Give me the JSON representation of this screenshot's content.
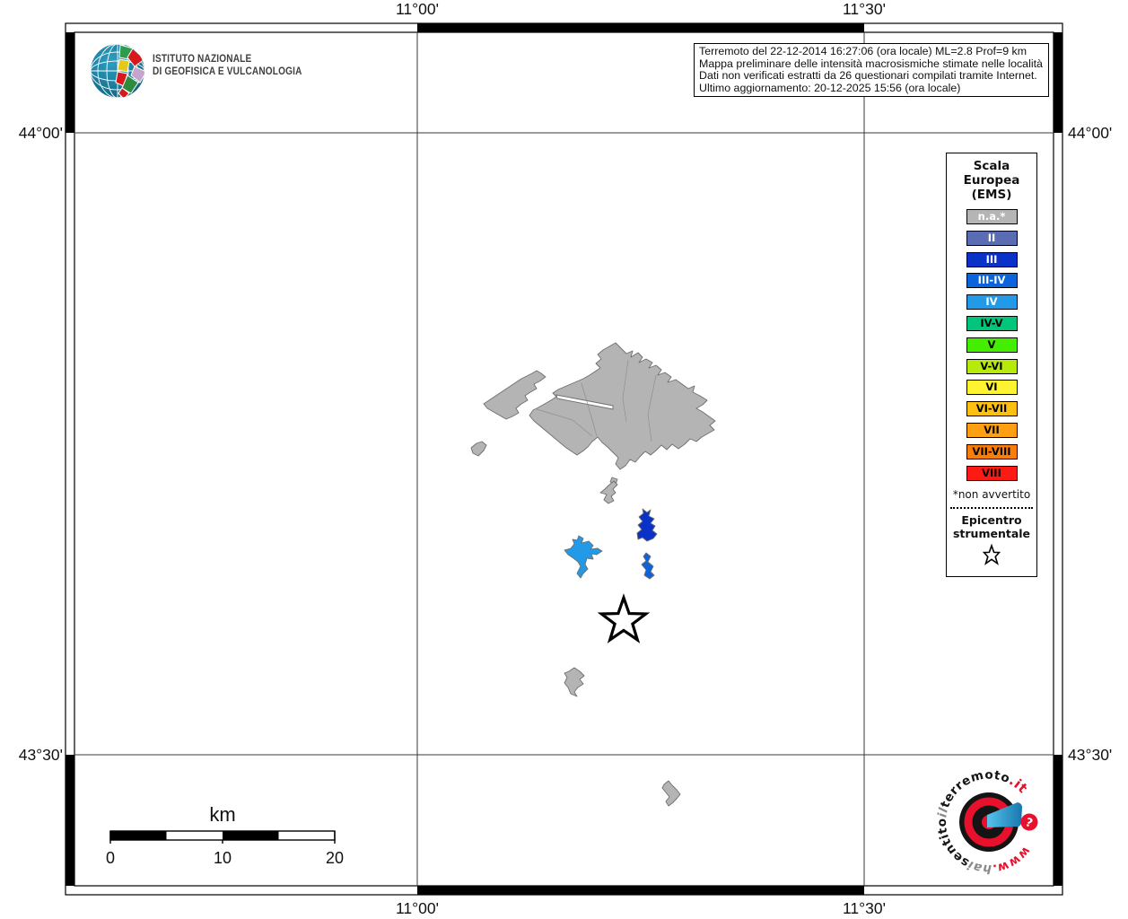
{
  "header": {
    "ingv_line1": "ISTITUTO NAZIONALE",
    "ingv_line2": "DI GEOFISICA E VULCANOLOGIA",
    "info_lines": [
      "Terremoto del 22-12-2014 16:27:06 (ora locale) ML=2.8 Prof=9 km",
      "Mappa preliminare delle intensità macrosismiche stimate nelle località",
      "Dati non verificati estratti da 26 questionari compilati tramite Internet.",
      "Ultimo aggiornamento: 20-12-2025 15:56 (ora locale)"
    ]
  },
  "map": {
    "lon_labels": [
      "11°00'",
      "11°30'"
    ],
    "lat_labels": [
      "44°00'",
      "43°30'"
    ],
    "colors": {
      "land": "#b4b4b4",
      "intensity_iii": "#0a32c8",
      "intensity_iii_iv": "#0b64dc",
      "intensity_iv": "#239ae8"
    }
  },
  "legend": {
    "title_lines": [
      "Scala",
      "Europea",
      "(EMS)"
    ],
    "items": [
      {
        "label": "n.a.*",
        "color": "#b5b5b5",
        "text_color": "#ffffff"
      },
      {
        "label": "II",
        "color": "#5a6db2",
        "text_color": "#ffffff"
      },
      {
        "label": "III",
        "color": "#0a32c8",
        "text_color": "#ffffff"
      },
      {
        "label": "III-IV",
        "color": "#0b64dc",
        "text_color": "#ffffff"
      },
      {
        "label": "IV",
        "color": "#239ae8",
        "text_color": "#ffffff"
      },
      {
        "label": "IV-V",
        "color": "#00c57a",
        "text_color": "#000000"
      },
      {
        "label": "V",
        "color": "#44ee00",
        "text_color": "#000000"
      },
      {
        "label": "V-VI",
        "color": "#b6ea0b",
        "text_color": "#000000"
      },
      {
        "label": "VI",
        "color": "#fdf330",
        "text_color": "#000000"
      },
      {
        "label": "VI-VII",
        "color": "#fdc010",
        "text_color": "#000000"
      },
      {
        "label": "VII",
        "color": "#fe9e11",
        "text_color": "#000000"
      },
      {
        "label": "VII-VIII",
        "color": "#f87d09",
        "text_color": "#000000"
      },
      {
        "label": "VIII",
        "color": "#fb1b14",
        "text_color": "#000000"
      }
    ],
    "footnote": "*non avvertito",
    "epicenter_lines": [
      "Epicentro",
      "strumentale"
    ]
  },
  "scalebar": {
    "title": "km",
    "ticks": [
      "0",
      "10",
      "20"
    ]
  },
  "site_logo": {
    "www": "www.",
    "hai": "hai",
    "sentito": "sentito",
    "il": "il",
    "terremoto": "terremoto",
    "it": ".it",
    "question": "?",
    "red": "#e8112d",
    "blue": "#2f9fd8"
  }
}
